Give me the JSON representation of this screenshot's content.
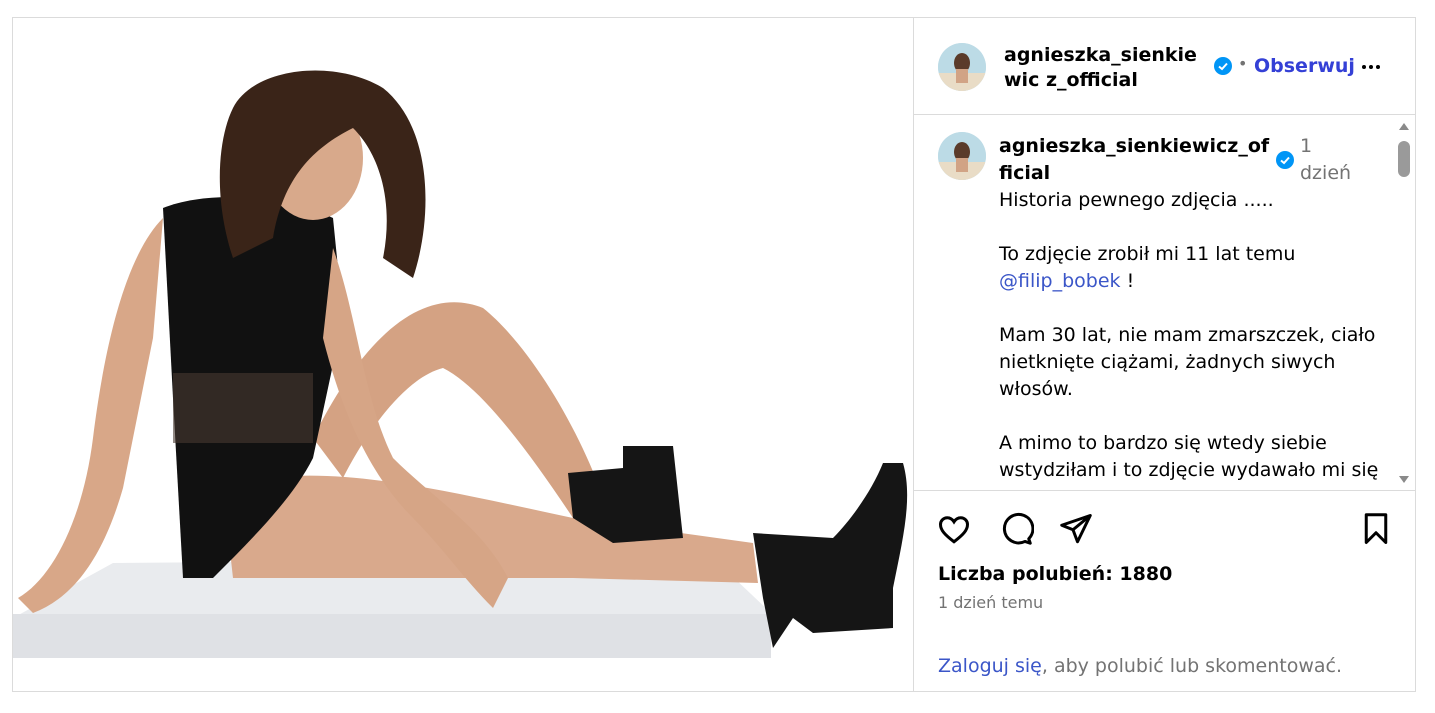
{
  "post": {
    "username": "agnieszka_sienkiewicz_official",
    "username_display": "agnieszka_sienkiewic z_official",
    "follow_label": "Obserwuj",
    "separator": "•",
    "photo_alt": "Woman in black bodysuit and black ankle boots sitting on white block"
  },
  "comment": {
    "username": "agnieszka_sienkiewicz_official",
    "time": "1 dzień",
    "caption": {
      "line1": "Historia pewnego zdjęcia .....",
      "line2_text": "To zdjęcie zrobił mi 11 lat temu",
      "mention": "@filip_bobek",
      "line2_suffix": " !",
      "line3": "Mam 30 lat, nie mam zmarszczek, ciało nietknięte ciążami, żadnych siwych włosów.",
      "line4": "A mimo to bardzo się wtedy siebie wstydziłam i to zdjęcie wydawało mi się"
    }
  },
  "actions": {
    "icons": [
      "heart-icon",
      "comment-icon",
      "share-icon",
      "bookmark-icon"
    ],
    "likes_label": "Liczba polubień: 1880",
    "time_ago": "1 dzień temu",
    "login_link": "Zaloguj się",
    "login_suffix": ", aby polubić lub skomentować."
  },
  "colors": {
    "link": "#3b56c8",
    "follow": "#3440d6",
    "verified": "#0095f6",
    "border": "#dbdbdb",
    "muted": "#737373"
  }
}
